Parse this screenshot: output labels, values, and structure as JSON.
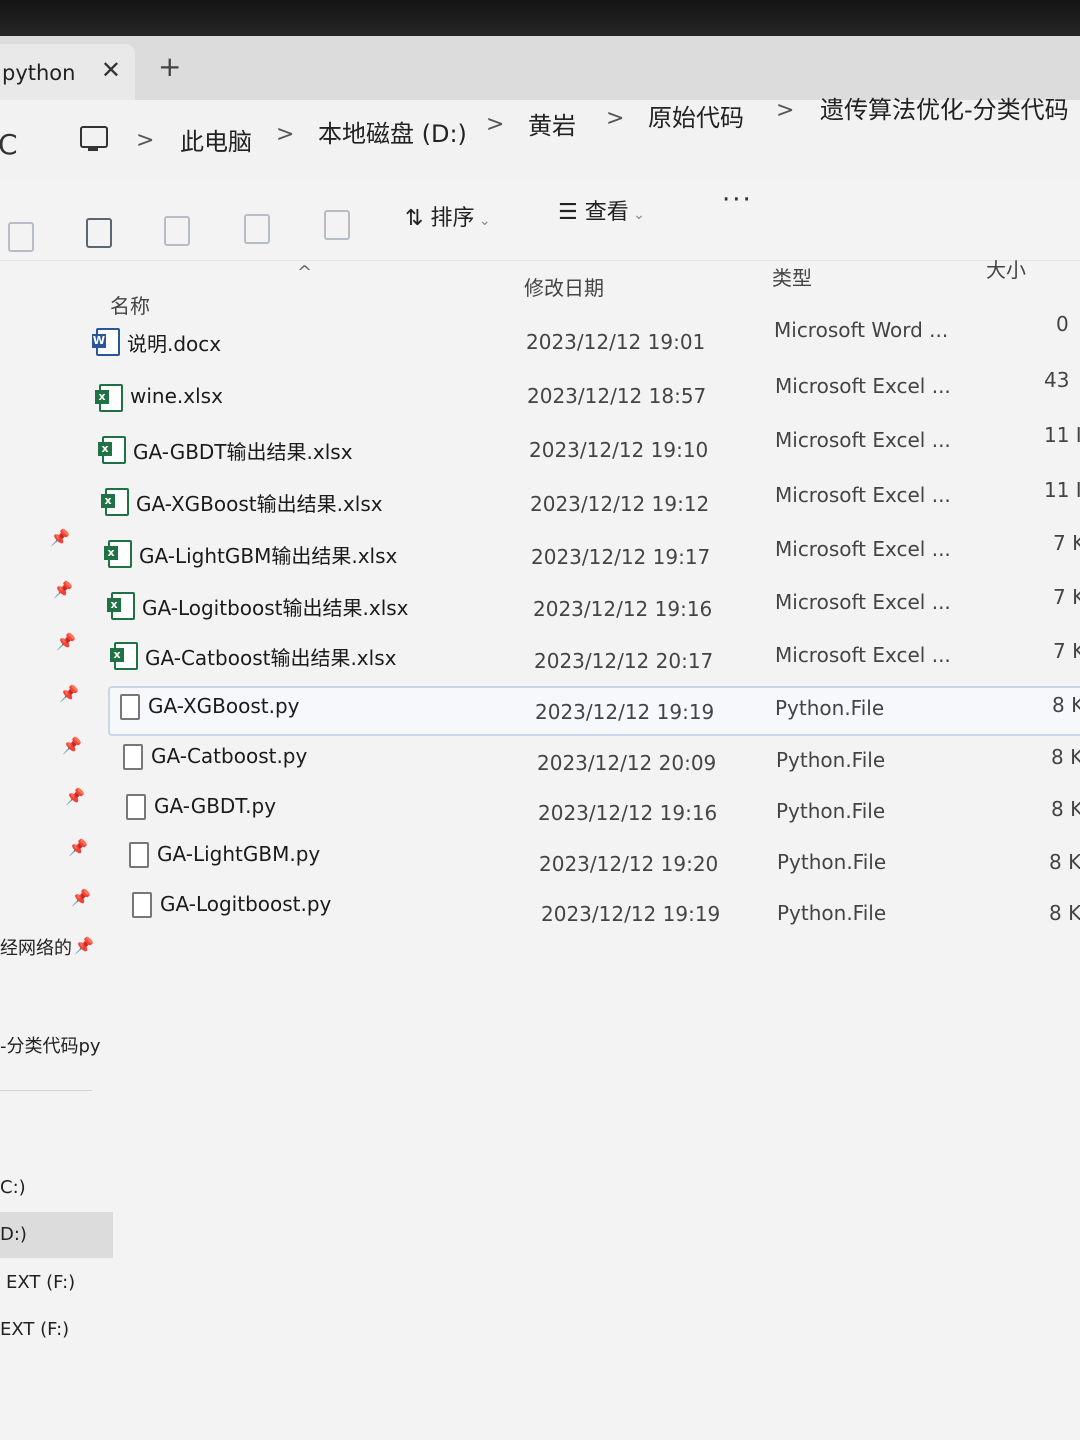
{
  "tab": {
    "title": "python",
    "close": "✕",
    "new": "+"
  },
  "address": {
    "refresh": "C",
    "crumbs": [
      "此电脑",
      "本地磁盘 (D:)",
      "黄岩",
      "原始代码",
      "遗传算法优化-分类代码"
    ],
    "separator": ">"
  },
  "toolbar": {
    "sort_label": "排序",
    "view_label": "查看",
    "more": "···"
  },
  "columns": {
    "name": "名称",
    "date": "修改日期",
    "type": "类型",
    "size": "大小"
  },
  "files": [
    {
      "name": "说明.docx",
      "date": "2023/12/12 19:01",
      "type": "Microsoft Word ...",
      "size": "0",
      "icon": "word"
    },
    {
      "name": "wine.xlsx",
      "date": "2023/12/12 18:57",
      "type": "Microsoft Excel ...",
      "size": "43",
      "icon": "excel"
    },
    {
      "name": "GA-GBDT输出结果.xlsx",
      "date": "2023/12/12 19:10",
      "type": "Microsoft Excel ...",
      "size": "11 I",
      "icon": "excel"
    },
    {
      "name": "GA-XGBoost输出结果.xlsx",
      "date": "2023/12/12 19:12",
      "type": "Microsoft Excel ...",
      "size": "11 I",
      "icon": "excel"
    },
    {
      "name": "GA-LightGBM输出结果.xlsx",
      "date": "2023/12/12 19:17",
      "type": "Microsoft Excel ...",
      "size": "7 K",
      "icon": "excel"
    },
    {
      "name": "GA-Logitboost输出结果.xlsx",
      "date": "2023/12/12 19:16",
      "type": "Microsoft Excel ...",
      "size": "7 K",
      "icon": "excel"
    },
    {
      "name": "GA-Catboost输出结果.xlsx",
      "date": "2023/12/12 20:17",
      "type": "Microsoft Excel ...",
      "size": "7 K",
      "icon": "excel"
    },
    {
      "name": "GA-XGBoost.py",
      "date": "2023/12/12 19:19",
      "type": "Python.File",
      "size": "8 K",
      "icon": "py",
      "selected": true
    },
    {
      "name": "GA-Catboost.py",
      "date": "2023/12/12 20:09",
      "type": "Python.File",
      "size": "8 K",
      "icon": "py"
    },
    {
      "name": "GA-GBDT.py",
      "date": "2023/12/12 19:16",
      "type": "Python.File",
      "size": "8 K",
      "icon": "py"
    },
    {
      "name": "GA-LightGBM.py",
      "date": "2023/12/12 19:20",
      "type": "Python.File",
      "size": "8 K",
      "icon": "py"
    },
    {
      "name": "GA-Logitboost.py",
      "date": "2023/12/12 19:19",
      "type": "Python.File",
      "size": "8 K",
      "icon": "py"
    }
  ],
  "nav": {
    "item_neural": "经网络的",
    "item_classify": "-分类代码py",
    "drive_c": "C:)",
    "drive_d": "D:)",
    "drive_ext1": "EXT (F:)",
    "drive_ext2": "EXT (F:)"
  }
}
